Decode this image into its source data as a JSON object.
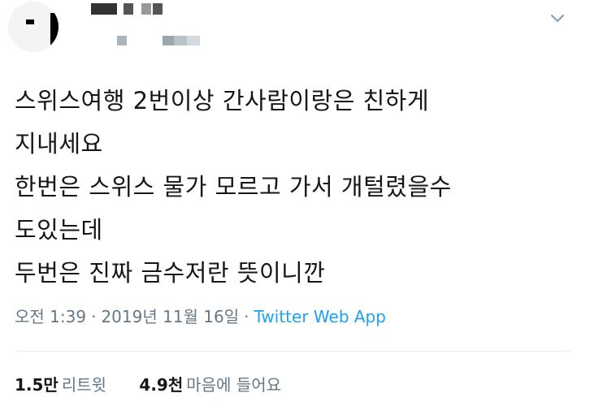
{
  "tweet": {
    "lines": [
      "스위스여행 2번이상 간사람이랑은 친하게",
      "지내세요",
      "한번은 스위스 물가 모르고 가서 개털렸을수",
      "도있는데",
      "두번은 진짜 금수저란 뜻이니깐"
    ],
    "time": "오전 1:39",
    "date": "2019년 11월 16일",
    "separator": "·",
    "source": "Twitter Web App"
  },
  "stats": {
    "retweets_count": "1.5만",
    "retweets_label": "리트윗",
    "likes_count": "4.9천",
    "likes_label": "마음에 들어요"
  },
  "colors": {
    "text": "#14171a",
    "secondary": "#657786",
    "accent": "#1da1f2",
    "divider": "#e6ecf0"
  },
  "icons": {
    "menu": "chevron-down-icon"
  }
}
